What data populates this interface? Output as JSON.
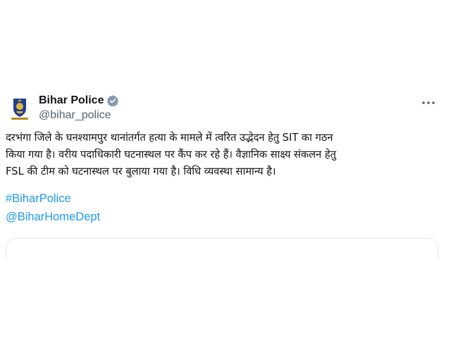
{
  "author": {
    "display_name": "Bihar Police",
    "handle": "@bihar_police",
    "avatar_icon": "bihar-police-emblem-icon",
    "verified_icon": "verified-badge-icon"
  },
  "tweet": {
    "text_lines": [
      "दरभंगा जिले के घनश्यामपुर थानांतर्गत हत्या के मामले में त्वरित उद्भेदन हेतु SIT का गठन",
      "किया गया है। वरीय पदाधिकारी घटनास्थल पर कैंप कर रहे हैं। वैज्ञानिक साक्ष्य संकलन हेतु",
      "FSL की टीम को घटनास्थल पर बुलाया गया है। विधि व्यवस्था सामान्य है।"
    ],
    "hashtag": "#BiharPolice",
    "mention": "@BiharHomeDept"
  },
  "menu": {
    "icon": "more-options-icon"
  },
  "colors": {
    "link": "#1d9bf0",
    "text": "#0f1419",
    "secondary": "#536471",
    "verified": "#829aab"
  }
}
